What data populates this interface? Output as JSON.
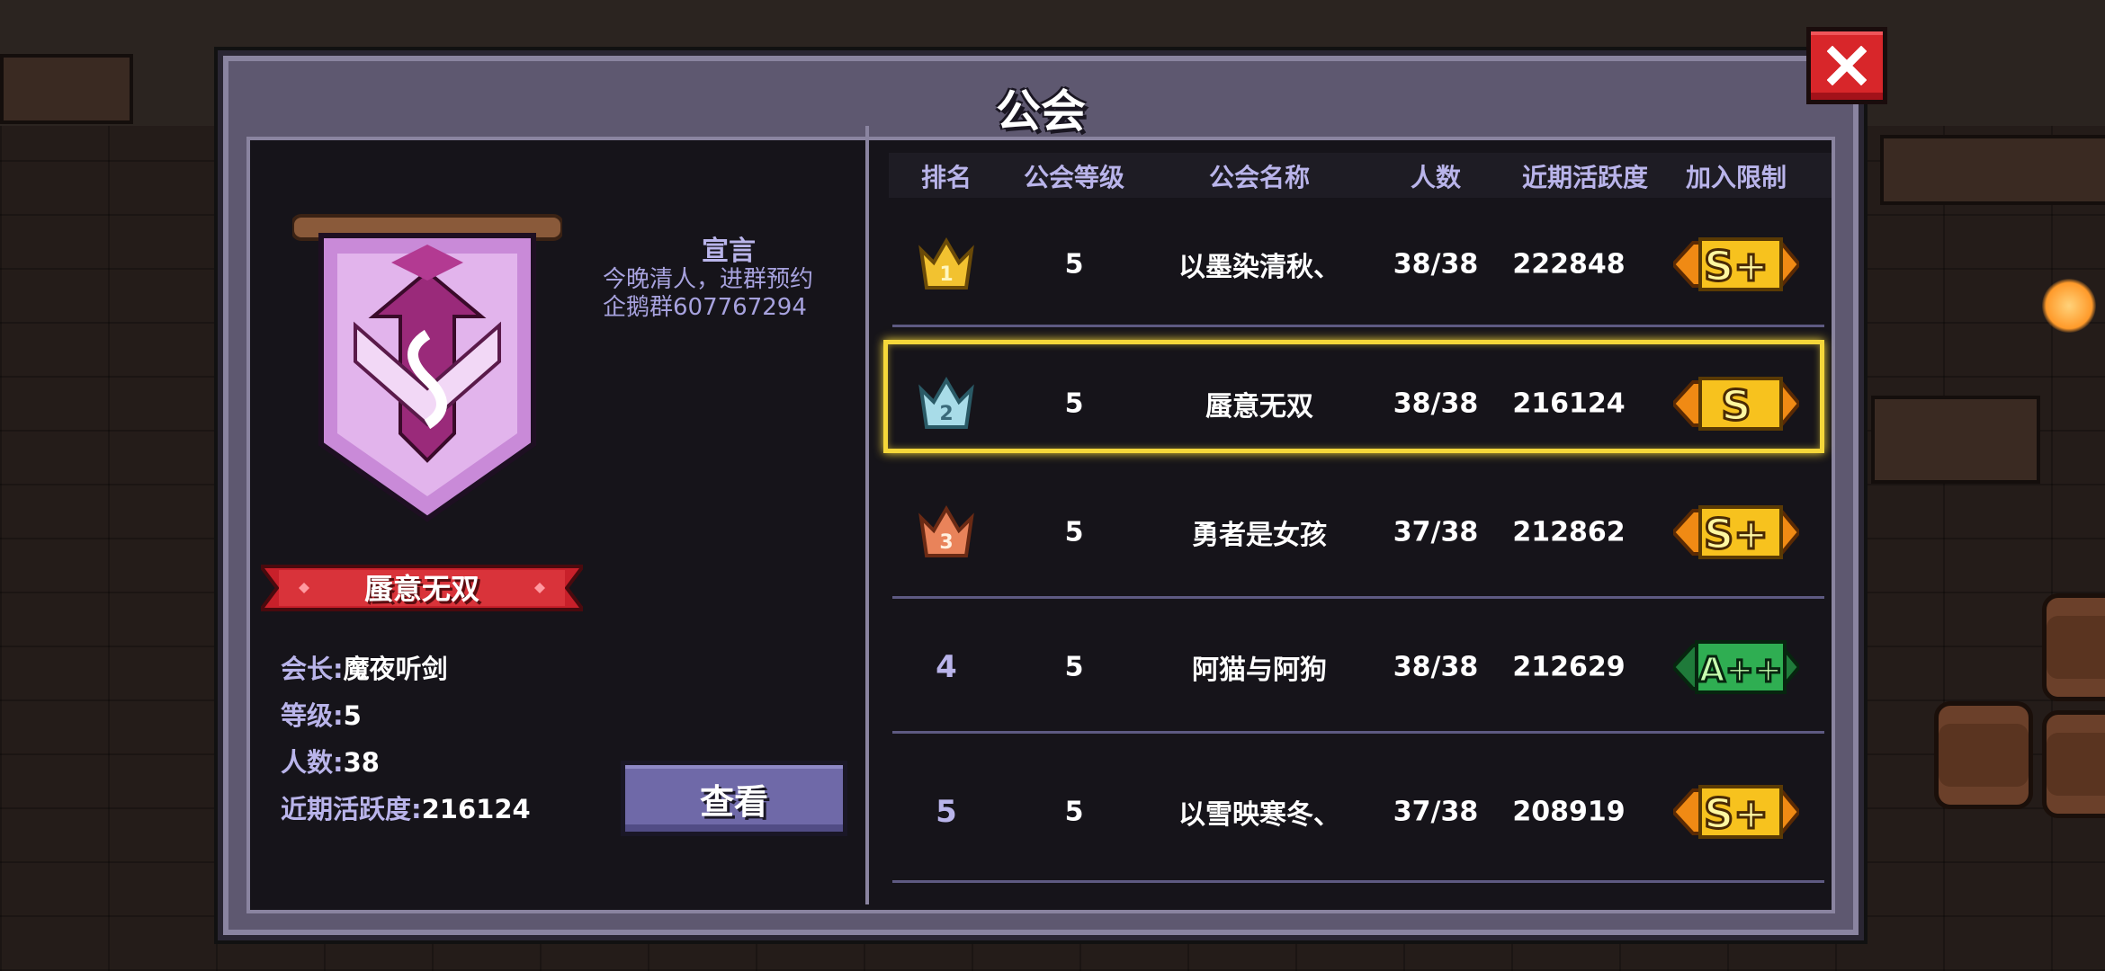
{
  "dialog": {
    "title": "公会"
  },
  "colors": {
    "panel": "#5e5870",
    "inner": "#16141a",
    "accent_text": "#b9b4ea",
    "selected_border": "#f5d73a",
    "close_red": "#d8262a",
    "button_purple": "#6f69a8",
    "banner_red": "#c8202a"
  },
  "guild": {
    "banner_icon": "guild-emblem-s",
    "name": "蜃意无双",
    "leader_label": "会长:",
    "leader": "魔夜听剑",
    "level_label": "等级:",
    "level": "5",
    "members_label": "人数:",
    "members": "38",
    "activity_label": "近期活跃度:",
    "activity": "216124",
    "manifesto_title": "宣言",
    "manifesto_line1": "今晚清人，进群预约",
    "manifesto_line2": "企鹅群607767294",
    "view_button": "查看"
  },
  "table": {
    "headers": [
      "排名",
      "公会等级",
      "公会名称",
      "人数",
      "近期活跃度",
      "加入限制"
    ],
    "rows": [
      {
        "rank": "1",
        "rank_icon": "gold-crown-icon",
        "level": "5",
        "name": "以墨染清秋、",
        "members": "38/38",
        "activity": "222848",
        "limit": "S+",
        "limit_icon": "rank-s-plus-badge"
      },
      {
        "rank": "2",
        "rank_icon": "silver-crown-icon",
        "level": "5",
        "name": "蜃意无双",
        "members": "38/38",
        "activity": "216124",
        "limit": "S",
        "limit_icon": "rank-s-badge"
      },
      {
        "rank": "3",
        "rank_icon": "bronze-crown-icon",
        "level": "5",
        "name": "勇者是女孩",
        "members": "37/38",
        "activity": "212862",
        "limit": "S+",
        "limit_icon": "rank-s-plus-badge"
      },
      {
        "rank": "4",
        "rank_icon": "",
        "level": "5",
        "name": "阿猫与阿狗",
        "members": "38/38",
        "activity": "212629",
        "limit": "A++",
        "limit_icon": "rank-a-plus-plus-badge"
      },
      {
        "rank": "5",
        "rank_icon": "",
        "level": "5",
        "name": "以雪映寒冬、",
        "members": "37/38",
        "activity": "208919",
        "limit": "S+",
        "limit_icon": "rank-s-plus-badge"
      }
    ]
  }
}
